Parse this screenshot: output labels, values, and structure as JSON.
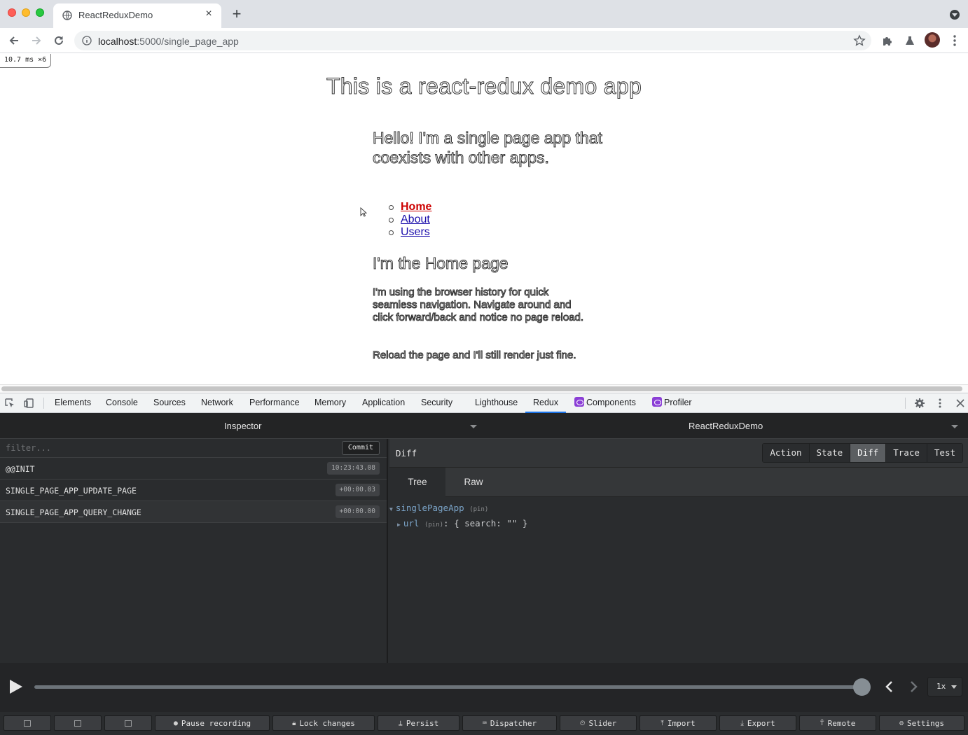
{
  "browser": {
    "tab_title": "ReactReduxDemo",
    "url_host": "localhost",
    "url_rest": ":5000/single_page_app"
  },
  "page": {
    "fps_meter": "10.7 ms ×6",
    "title": "This is a react-redux demo app",
    "hello": "Hello! I'm a single page app that coexists with other apps.",
    "nav": [
      "Home",
      "About",
      "Users"
    ],
    "subtitle": "I'm the Home page",
    "paragraph1": "I'm using the browser history for quick seamless navigation. Navigate around and click forward/back and notice no page reload.",
    "paragraph2": "Reload the page and I'll still render just fine."
  },
  "devtools": {
    "tabs": [
      "Elements",
      "Console",
      "Sources",
      "Network",
      "Performance",
      "Memory",
      "Application",
      "Security",
      "Lighthouse",
      "Redux",
      "Components",
      "Profiler"
    ],
    "active_tab": "Redux"
  },
  "redux": {
    "monitor": "Inspector",
    "instance": "ReactReduxDemo",
    "filter_placeholder": "filter...",
    "commit_label": "Commit",
    "actions": [
      {
        "name": "@@INIT",
        "time": "10:23:43.08"
      },
      {
        "name": "SINGLE_PAGE_APP_UPDATE_PAGE",
        "time": "+00:00.03"
      },
      {
        "name": "SINGLE_PAGE_APP_QUERY_CHANGE",
        "time": "+00:00.00"
      }
    ],
    "panel_title": "Diff",
    "view_buttons": [
      "Action",
      "State",
      "Diff",
      "Trace",
      "Test"
    ],
    "active_view": "Diff",
    "subtabs": [
      "Tree",
      "Raw"
    ],
    "active_subtab": "Tree",
    "tree": {
      "root_key": "singlePageApp",
      "root_pin": "(pin)",
      "child_key": "url",
      "child_pin": "(pin)",
      "child_value": ": { search: \"\" }"
    },
    "speed": "1x",
    "progress": 1.0,
    "bottom_buttons": [
      "Pause recording",
      "Lock changes",
      "Persist",
      "Dispatcher",
      "Slider",
      "Import",
      "Export",
      "Remote",
      "Settings"
    ]
  },
  "colors": {
    "link_active": "#cc0000",
    "link": "#1a0dab",
    "devtools_accent": "#1a73e8",
    "redux_bg": "#2a2c2e"
  }
}
